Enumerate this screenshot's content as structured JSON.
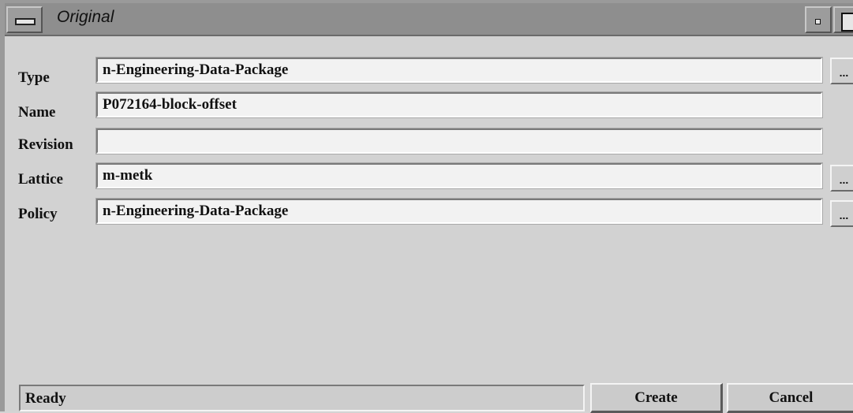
{
  "window": {
    "title": "Original",
    "icons": [
      "window-menu-icon",
      "minimize-icon",
      "maximize-icon"
    ]
  },
  "form": {
    "rows": [
      {
        "label": "Type",
        "value": "n-Engineering-Data-Package",
        "browse": "..."
      },
      {
        "label": "Name",
        "value": "P072164-block-offset"
      },
      {
        "label": "Revision",
        "value": ""
      },
      {
        "label": "Lattice",
        "value": "m-metk",
        "browse": "..."
      },
      {
        "label": "Policy",
        "value": "n-Engineering-Data-Package",
        "browse": "..."
      }
    ]
  },
  "footer": {
    "status": "Ready",
    "create_label": "Create",
    "cancel_label": "Cancel"
  }
}
